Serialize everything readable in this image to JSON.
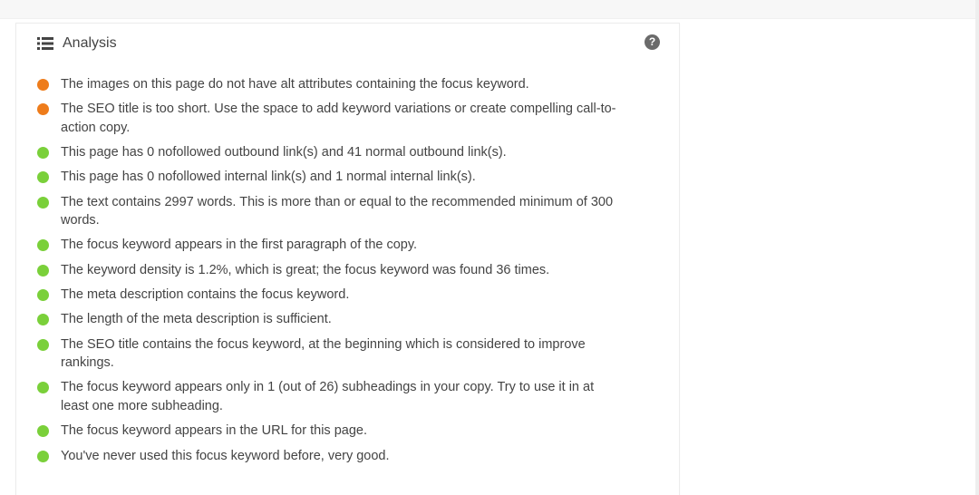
{
  "panel": {
    "title": "Analysis",
    "icon": "list-icon",
    "help_icon": "question-circle-icon",
    "help_glyph": "?"
  },
  "colors": {
    "bad": "#ee7c1b",
    "good": "#7ad03a"
  },
  "results": [
    {
      "status": "bad",
      "text": "The images on this page do not have alt attributes containing the focus keyword."
    },
    {
      "status": "bad",
      "text": "The SEO title is too short. Use the space to add keyword variations or create compelling call-to-action copy."
    },
    {
      "status": "good",
      "text": "This page has 0 nofollowed outbound link(s) and 41 normal outbound link(s)."
    },
    {
      "status": "good",
      "text": "This page has 0 nofollowed internal link(s) and 1 normal internal link(s)."
    },
    {
      "status": "good",
      "text": "The text contains 2997 words. This is more than or equal to the recommended minimum of 300 words."
    },
    {
      "status": "good",
      "text": "The focus keyword appears in the first paragraph of the copy."
    },
    {
      "status": "good",
      "text": "The keyword density is 1.2%, which is great; the focus keyword was found 36 times."
    },
    {
      "status": "good",
      "text": "The meta description contains the focus keyword."
    },
    {
      "status": "good",
      "text": "The length of the meta description is sufficient."
    },
    {
      "status": "good",
      "text": "The SEO title contains the focus keyword, at the beginning which is considered to improve rankings."
    },
    {
      "status": "good",
      "text": "The focus keyword appears only in 1 (out of 26) subheadings in your copy. Try to use it in at least one more subheading."
    },
    {
      "status": "good",
      "text": "The focus keyword appears in the URL for this page."
    },
    {
      "status": "good",
      "text": "You've never used this focus keyword before, very good."
    }
  ]
}
